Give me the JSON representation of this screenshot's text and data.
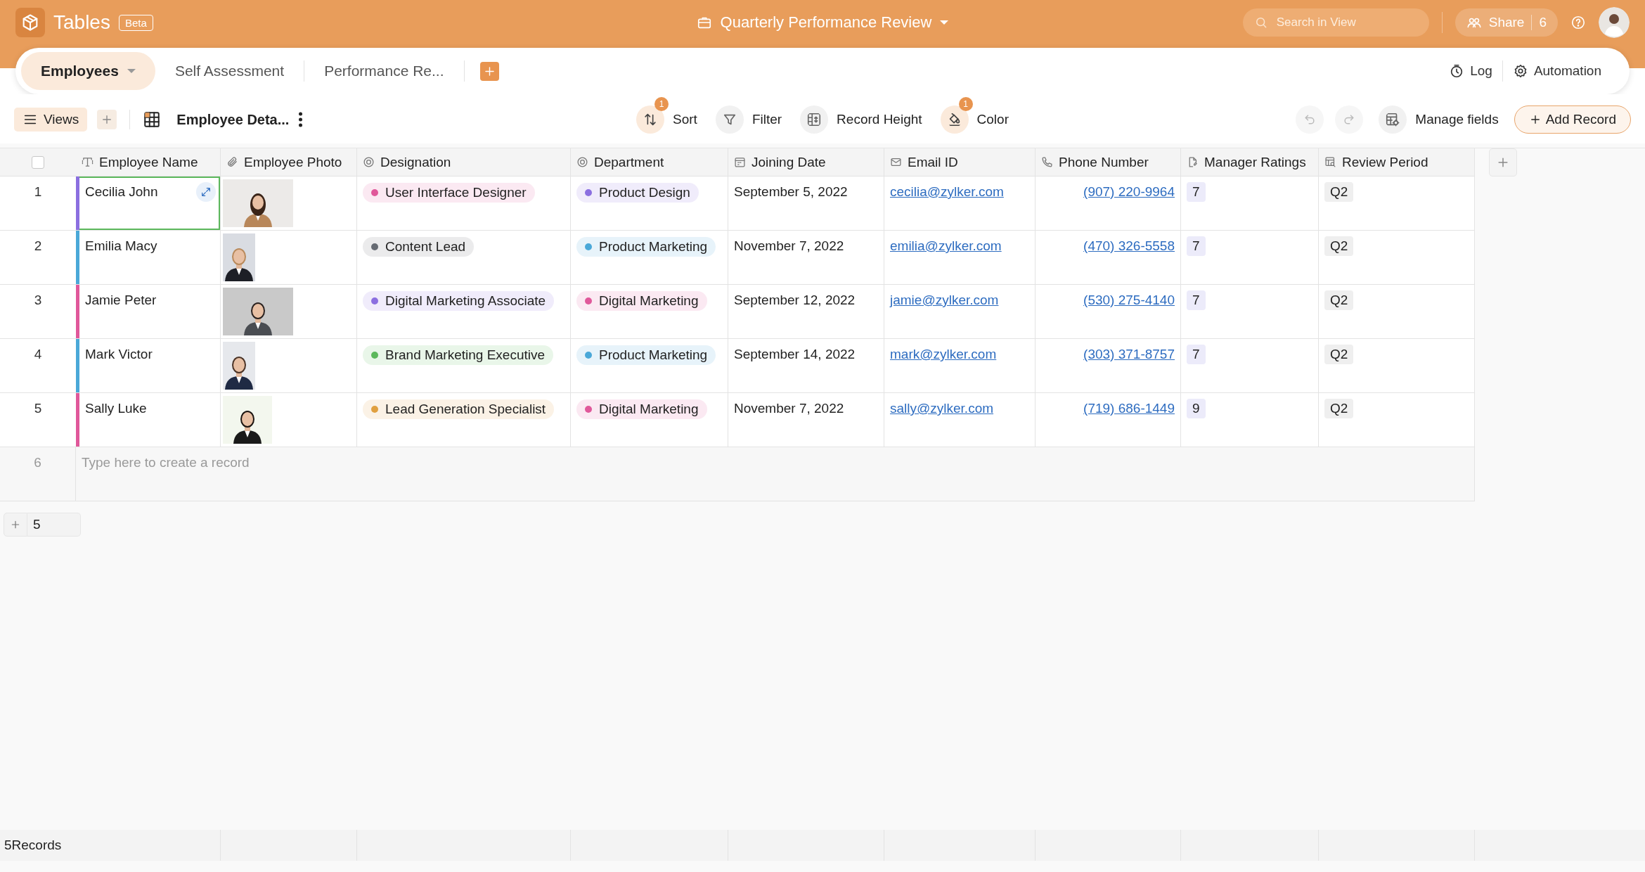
{
  "app": {
    "name": "Tables",
    "badge": "Beta"
  },
  "document_title": "Quarterly Performance Review",
  "search": {
    "placeholder": "Search in View"
  },
  "share": {
    "label": "Share",
    "count": "6"
  },
  "tabs": [
    {
      "label": "Employees",
      "selected": true
    },
    {
      "label": "Self Assessment",
      "selected": false
    },
    {
      "label": "Performance Re...",
      "selected": false
    }
  ],
  "tab_actions": [
    {
      "label": "Log",
      "kind": "log"
    },
    {
      "label": "Automation",
      "kind": "automation"
    }
  ],
  "toolbar": {
    "views": "Views",
    "view_name": "Employee Deta...",
    "tools": [
      {
        "label": "Sort",
        "kind": "sort",
        "badge": "1",
        "active": true
      },
      {
        "label": "Filter",
        "kind": "filter",
        "active": false
      },
      {
        "label": "Record Height",
        "kind": "height",
        "active": false
      },
      {
        "label": "Color",
        "kind": "color",
        "badge": "1",
        "active": true
      }
    ],
    "manage_fields": "Manage fields",
    "add_record": "Add Record"
  },
  "table": {
    "select_all_checked": false,
    "columns": [
      {
        "label": "Employee Name",
        "kind": "text"
      },
      {
        "label": "Employee Photo"
      },
      {
        "label": "Designation",
        "kind": "select"
      },
      {
        "label": "Department",
        "kind": "select"
      },
      {
        "label": "Joining Date",
        "kind": "date"
      },
      {
        "label": "Email ID",
        "kind": "email"
      },
      {
        "label": "Phone Number",
        "kind": "phone"
      },
      {
        "label": "Manager Ratings",
        "kind": "rating"
      },
      {
        "label": "Review Period",
        "kind": "period"
      }
    ],
    "rows": [
      {
        "number": "1",
        "color": "#8b6fe0",
        "selected": true,
        "cells": [
          "Cecilia John",
          {
            "kind": "picture"
          },
          {
            "label": "User Interface Designer",
            "color": "#e0589a"
          },
          {
            "label": "Product Design",
            "color": "#8b6fe0"
          },
          "September 5, 2022",
          "cecilia@zylker.com",
          "(907) 220-9964",
          "7",
          "Q2"
        ]
      },
      {
        "number": "2",
        "color": "#4aa8d8",
        "selected": false,
        "cells": [
          "Emilia Macy",
          {
            "kind": "picture"
          },
          {
            "label": "Content Lead",
            "color": "#666b73"
          },
          {
            "label": "Product Marketing",
            "color": "#4aa8d8"
          },
          "November 7, 2022",
          "emilia@zylker.com",
          "(470) 326-5558",
          "7",
          "Q2"
        ]
      },
      {
        "number": "3",
        "color": "#e0589a",
        "selected": false,
        "cells": [
          "Jamie Peter",
          {
            "kind": "picture"
          },
          {
            "label": "Digital Marketing Associate",
            "color": "#8b6fe0"
          },
          {
            "label": "Digital Marketing",
            "color": "#e0589a"
          },
          "September 12, 2022",
          "jamie@zylker.com",
          "(530) 275-4140",
          "7",
          "Q2"
        ]
      },
      {
        "number": "4",
        "color": "#4aa8d8",
        "selected": false,
        "cells": [
          "Mark Victor",
          {
            "kind": "picture"
          },
          {
            "label": "Brand Marketing Executive",
            "color": "#5cb85c"
          },
          {
            "label": "Product Marketing",
            "color": "#4aa8d8"
          },
          "September 14, 2022",
          "mark@zylker.com",
          "(303) 371-8757",
          "7",
          "Q2"
        ]
      },
      {
        "number": "5",
        "color": "#e0589a",
        "selected": false,
        "cells": [
          "Sally Luke",
          {
            "kind": "picture"
          },
          {
            "label": "Lead Generation Specialist",
            "color": "#e0a040"
          },
          {
            "label": "Digital Marketing",
            "color": "#e0589a"
          },
          "November 7, 2022",
          "sally@zylker.com",
          "(719) 686-1449",
          "9",
          "Q2"
        ]
      }
    ],
    "new_row": {
      "number": "6",
      "placeholder": "Type here to create a record"
    }
  },
  "add_rows": {
    "count": "5"
  },
  "status_bar": "5Records"
}
